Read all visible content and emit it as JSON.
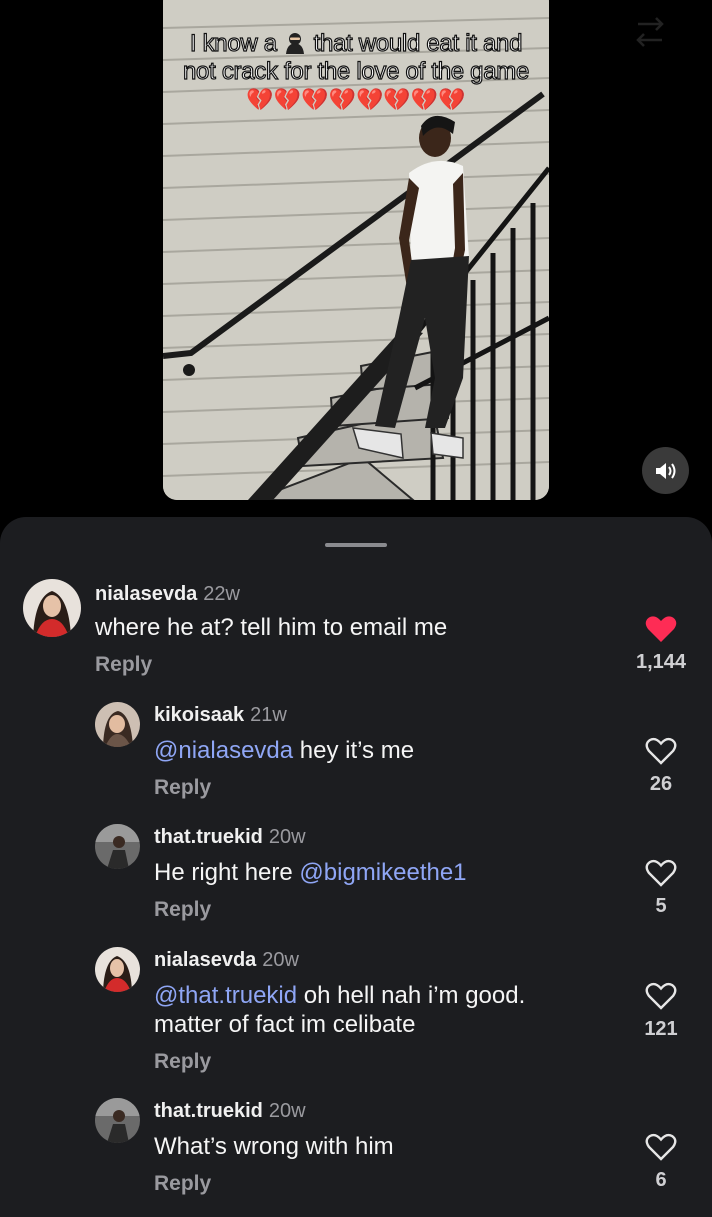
{
  "video": {
    "caption_part1": "I know a",
    "caption_part2": "that would eat it and not crack for the love of the game",
    "caption_hearts": "💔💔💔💔💔💔💔💔",
    "ninja_icon": "ninja-emoji",
    "sound_icon": "speaker-icon"
  },
  "colors": {
    "accent_like": "#fe2c55",
    "mention": "#8fa6f5",
    "sheet_bg": "#1c1d20"
  },
  "comments": [
    {
      "user": "nialasevda",
      "time": "22w",
      "text": "where he at? tell him to email me",
      "reply": "Reply",
      "likes": "1,144",
      "liked": true
    },
    {
      "user": "kikoisaak",
      "time": "21w",
      "mention": "@nialasevda",
      "text": " hey it’s me",
      "reply": "Reply",
      "likes": "26",
      "liked": false
    },
    {
      "user": "that.truekid",
      "time": "20w",
      "text": "He right here ",
      "mention": "@bigmikeethe1",
      "reply": "Reply",
      "likes": "5",
      "liked": false
    },
    {
      "user": "nialasevda",
      "time": "20w",
      "mention": "@that.truekid",
      "text": " oh hell nah i’m good.",
      "text2": "matter of fact im celibate",
      "reply": "Reply",
      "likes": "121",
      "liked": false
    },
    {
      "user": "that.truekid",
      "time": "20w",
      "text": "What’s wrong with him",
      "reply": "Reply",
      "likes": "6",
      "liked": false
    }
  ]
}
